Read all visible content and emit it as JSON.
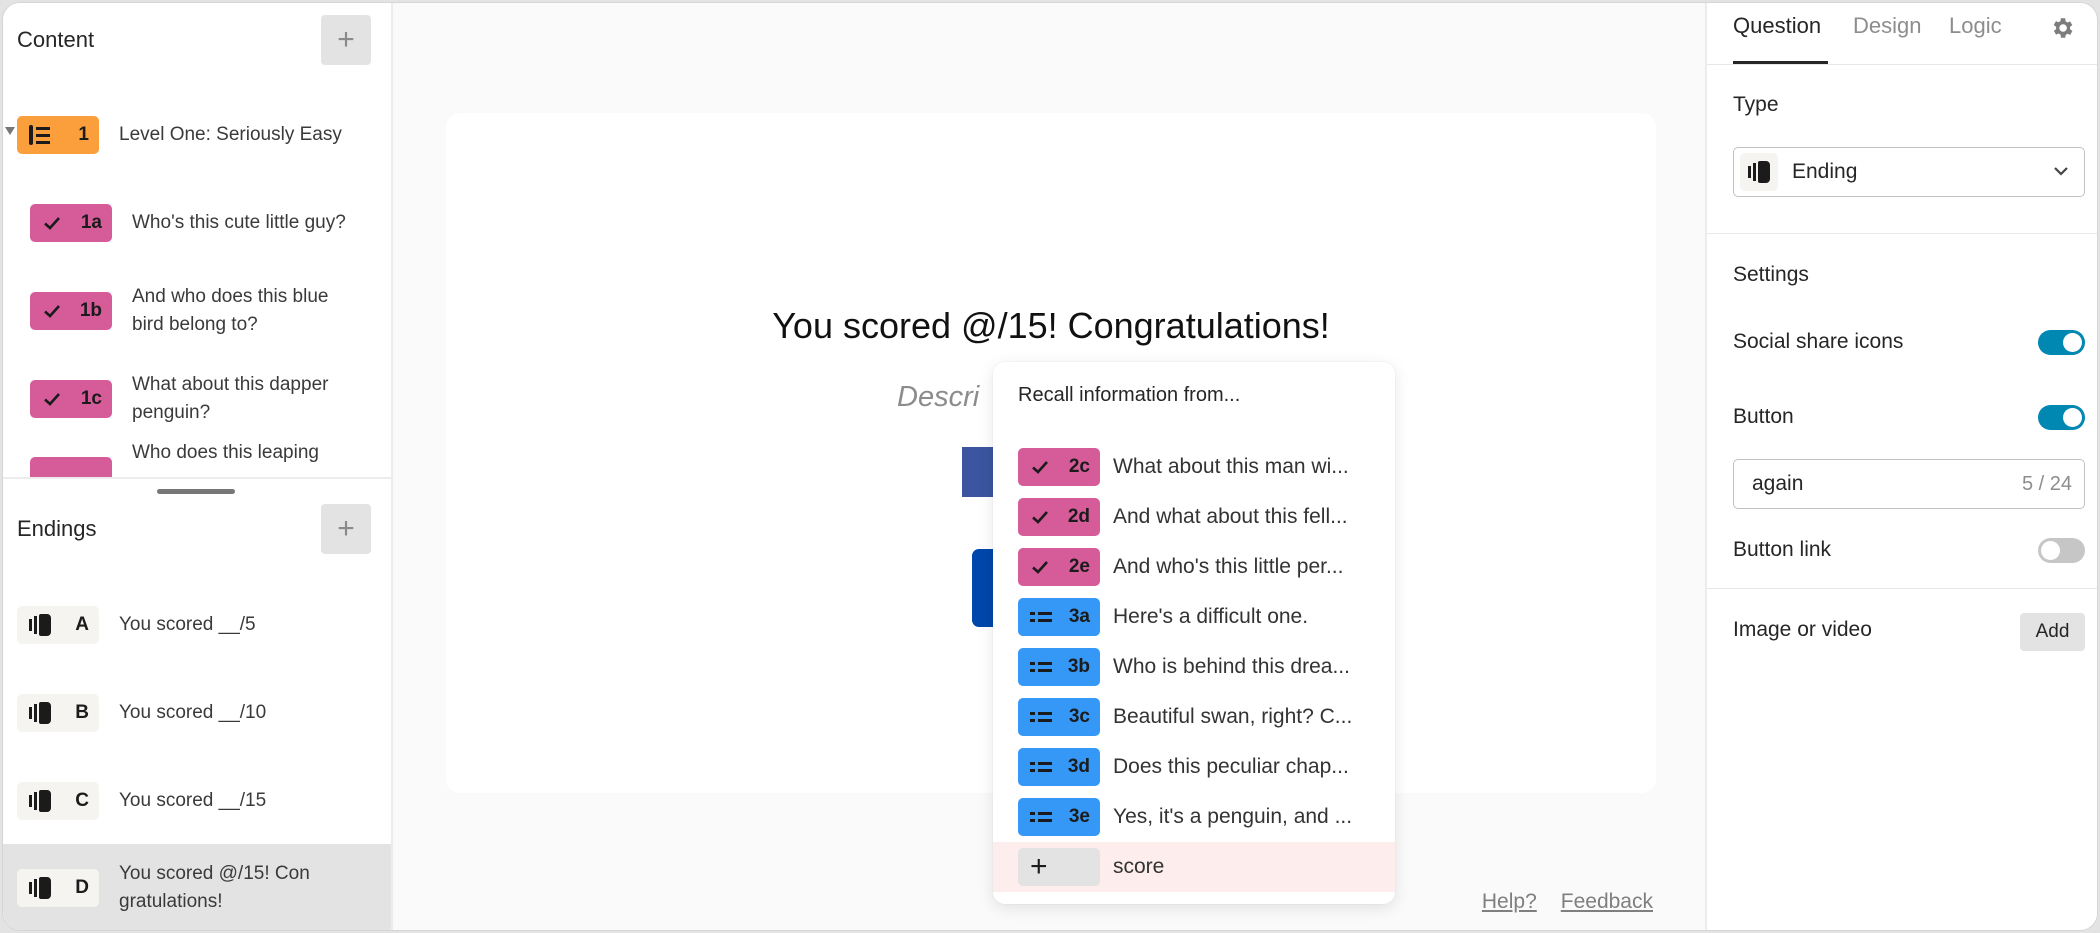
{
  "sidebar": {
    "content": {
      "title": "Content",
      "add_label": "+",
      "items": [
        {
          "badge": "1",
          "color": "orange",
          "icon": "question-group-icon",
          "label": "Level One: Seriously Easy"
        },
        {
          "badge": "1a",
          "color": "pink",
          "icon": "checkmark-icon",
          "label": "Who's this cute little guy?"
        },
        {
          "badge": "1b",
          "color": "pink",
          "icon": "checkmark-icon",
          "label": "And who does this blue bird belong to?"
        },
        {
          "badge": "1c",
          "color": "pink",
          "icon": "checkmark-icon",
          "label": "What about this dapper penguin?"
        },
        {
          "badge": "",
          "color": "pink",
          "icon": "checkmark-icon",
          "label": "Who does this leaping"
        }
      ]
    },
    "endings": {
      "title": "Endings",
      "add_label": "+",
      "items": [
        {
          "badge": "A",
          "label": "You scored __/5",
          "selected": false
        },
        {
          "badge": "B",
          "label": "You scored __/10",
          "selected": false
        },
        {
          "badge": "C",
          "label": "You scored __/15",
          "selected": false
        },
        {
          "badge": "D",
          "label": "You scored @/15! Con gratulations!",
          "selected": true
        }
      ]
    }
  },
  "canvas": {
    "title": "You scored @/15! Congratulations!",
    "description_placeholder": "Descri",
    "footer": {
      "help": "Help?",
      "feedback": "Feedback"
    }
  },
  "recall_popover": {
    "title": "Recall information from...",
    "items": [
      {
        "badge": "2c",
        "color": "pink",
        "icon": "checkmark-icon",
        "label": "What about this man wi..."
      },
      {
        "badge": "2d",
        "color": "pink",
        "icon": "checkmark-icon",
        "label": "And what about this fell..."
      },
      {
        "badge": "2e",
        "color": "pink",
        "icon": "checkmark-icon",
        "label": "And who's this little per..."
      },
      {
        "badge": "3a",
        "color": "blue",
        "icon": "short-text-icon",
        "label": "Here's a difficult one."
      },
      {
        "badge": "3b",
        "color": "blue",
        "icon": "short-text-icon",
        "label": "Who is behind this drea..."
      },
      {
        "badge": "3c",
        "color": "blue",
        "icon": "short-text-icon",
        "label": "Beautiful swan, right? C..."
      },
      {
        "badge": "3d",
        "color": "blue",
        "icon": "short-text-icon",
        "label": "Does this peculiar chap..."
      },
      {
        "badge": "3e",
        "color": "blue",
        "icon": "short-text-icon",
        "label": "Yes, it's a penguin, and ..."
      },
      {
        "badge": "+",
        "color": "plus",
        "icon": "plus-icon",
        "label": "score",
        "highlighted": true
      }
    ]
  },
  "right_panel": {
    "tabs": [
      {
        "label": "Question",
        "active": true
      },
      {
        "label": "Design",
        "active": false
      },
      {
        "label": "Logic",
        "active": false
      }
    ],
    "type": {
      "label": "Type",
      "value": "Ending"
    },
    "settings": {
      "label": "Settings",
      "social_share_icons": {
        "label": "Social share icons",
        "on": true
      },
      "button": {
        "label": "Button",
        "on": true,
        "value": "again",
        "counter": "5 / 24"
      },
      "button_link": {
        "label": "Button link",
        "on": false
      }
    },
    "image_or_video": {
      "label": "Image or video",
      "add_label": "Add"
    }
  },
  "colors": {
    "orange": "#fb9e3c",
    "pink": "#d65c99",
    "blue": "#3597f6",
    "toggle_on": "#0087b2",
    "facebook": "#3b55a0",
    "cta_button": "#0047ab",
    "highlight_row": "#fdeeed"
  }
}
